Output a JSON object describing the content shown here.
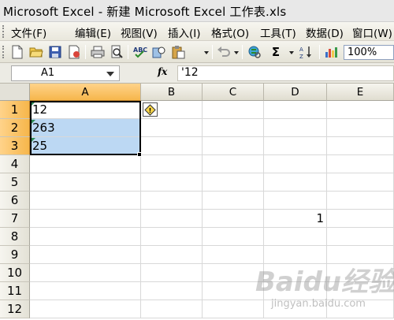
{
  "window": {
    "title": "Microsoft Excel - 新建 Microsoft Excel 工作表.xls"
  },
  "menu": {
    "items": [
      "文件(F)",
      "编辑(E)",
      "视图(V)",
      "插入(I)",
      "格式(O)",
      "工具(T)",
      "数据(D)",
      "窗口(W)"
    ]
  },
  "toolbar": {
    "zoom": "100%",
    "icons": [
      "new-icon",
      "open-icon",
      "save-icon",
      "permission-icon",
      "print-icon",
      "print-preview-icon",
      "spelling-icon",
      "research-icon",
      "paste-icon",
      "undo-icon",
      "hyperlink-icon",
      "autosum-icon",
      "sort-ascending-icon",
      "chart-wizard-icon"
    ],
    "autosum_glyph": "Σ"
  },
  "formula_bar": {
    "name_box": "A1",
    "fx": "fx",
    "content": "'12"
  },
  "sheet": {
    "columns": [
      "A",
      "B",
      "C",
      "D",
      "E"
    ],
    "rows": [
      "1",
      "2",
      "3",
      "4",
      "5",
      "6",
      "7",
      "8",
      "9",
      "10",
      "11",
      "12"
    ],
    "cells": {
      "A1": "12",
      "A2": "263",
      "A3": "25",
      "D7": "1"
    },
    "error_tag": "!",
    "selection": "A1:A3",
    "active_cell": "A1"
  },
  "watermark": {
    "brand": "Baidu经验",
    "url": "jingyan.baidu.com"
  }
}
